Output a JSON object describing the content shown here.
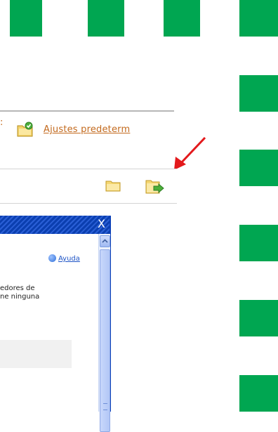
{
  "toolbar": {
    "fragment_label": ":",
    "ajustes_label": "Ajustes predeterm"
  },
  "dialog": {
    "close_label": "X",
    "help_label": "Ayuda",
    "text_line1": "edores de",
    "text_line2": "ne ninguna"
  },
  "colors": {
    "green_square": "#00a651",
    "link_orange": "#c36a1e",
    "annotation_red": "#e3191c",
    "titlebar_blue": "#0b3fb0"
  },
  "icons": {
    "ajustes": "folder-check-icon",
    "open": "folder-icon",
    "export": "export-arrow-icon",
    "help": "help-icon"
  }
}
